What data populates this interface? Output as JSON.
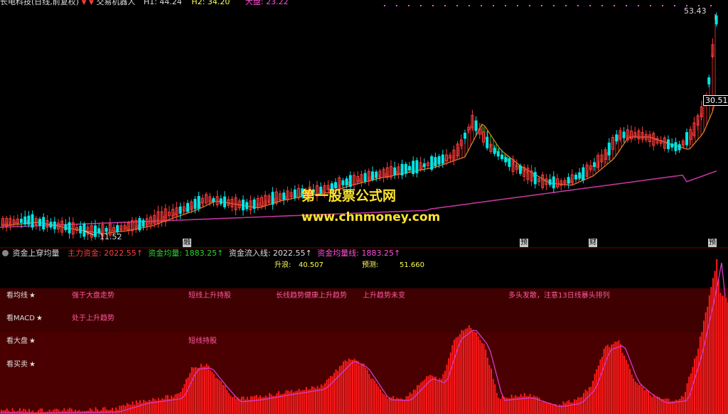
{
  "main_header": {
    "stock_title": "长电科技(日线,前复权)",
    "indicator_name": "交易机器人",
    "h1_label": "H1: 44.24",
    "h2_label": "H2: 34.20",
    "dapan_label": "大盘: 23.22"
  },
  "price_chart": {
    "high_label": "53.43",
    "low_label": "11.52",
    "current_price_label": "30.51",
    "event_markers": [
      "融",
      "预",
      "财",
      "预"
    ],
    "colors": {
      "up": "#ff3c3c",
      "down": "#00e5e5",
      "ma": "#e08a1e",
      "long_ma": "#c0359c",
      "cloud_up": "#d02a2a",
      "cloud_down": "#2bb52b",
      "bg": "#000000"
    }
  },
  "watermark": {
    "line1": "第一股票公式网",
    "line2": "www.chnmoney.com",
    "color": "#ffe52e"
  },
  "sub_header": {
    "indicator_name": "资金上穿均量",
    "main_fund": "主力资金: 2022.55",
    "fund_avg": "资金均量: 1883.25",
    "fund_inflow": "资金流入线: 2022.55",
    "fund_avg_line": "资金均量线: 1883.25"
  },
  "sub_panel": {
    "rise_label": "升浪:",
    "rise_value": "40.507",
    "forecast_label": "预测:",
    "forecast_value": "51.660",
    "rows": [
      {
        "label": "看均线",
        "signals": [
          "强于大盘走势",
          "短线上升持股",
          "长线趋势健康上升趋势",
          "上升趋势未变",
          "多头发散，注意13日线暴头排列"
        ]
      },
      {
        "label": "看MACD",
        "signals": [
          "处于上升趋势"
        ]
      },
      {
        "label": "看大盘",
        "signals": [
          "短线持股"
        ]
      },
      {
        "label": "看买卖",
        "signals": []
      }
    ]
  }
}
